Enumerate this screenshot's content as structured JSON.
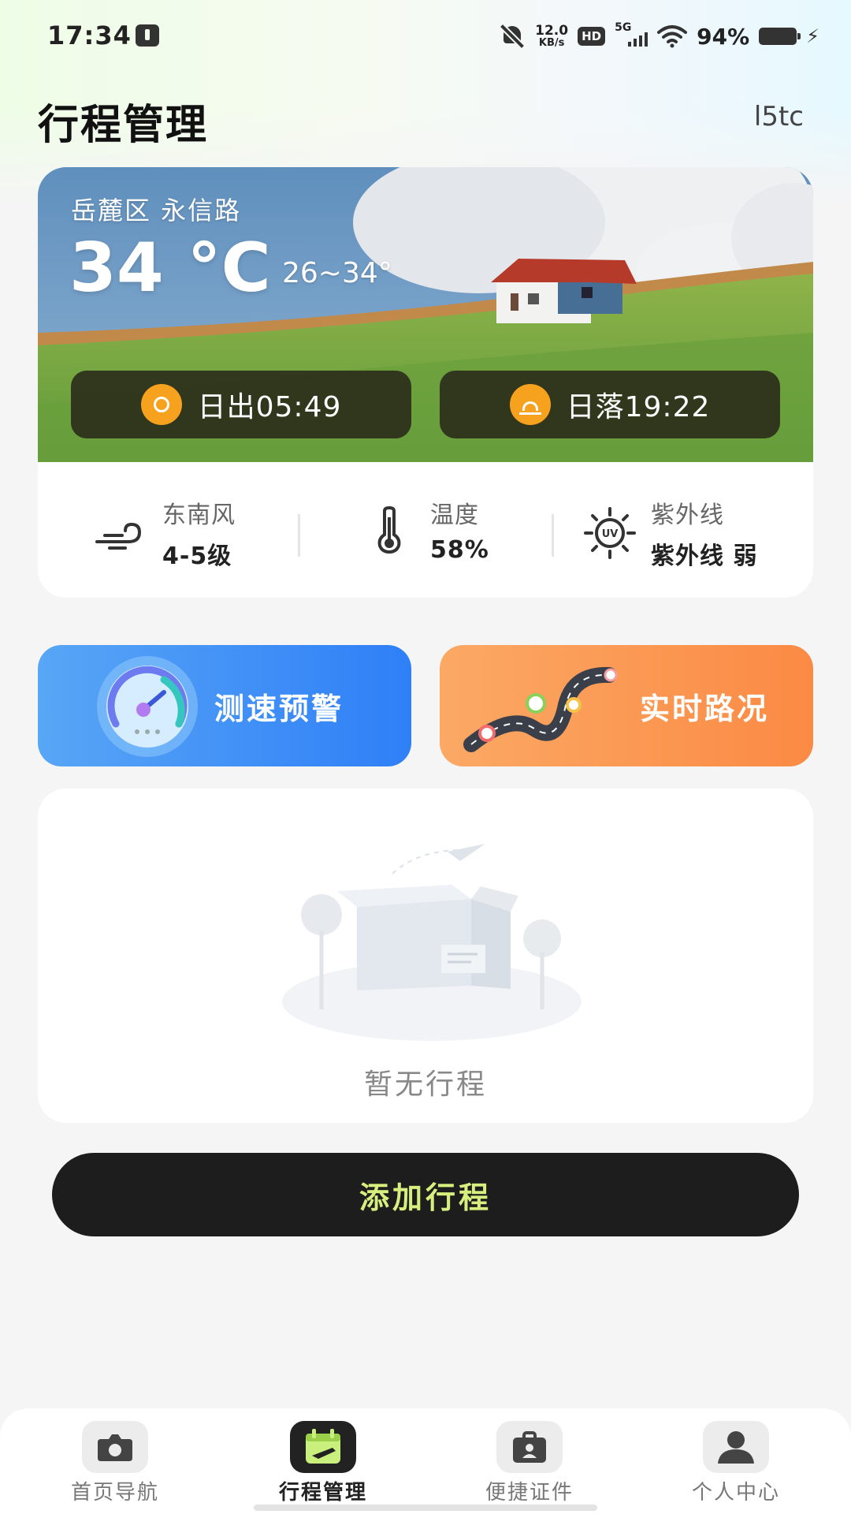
{
  "status_bar": {
    "time": "17:34",
    "net_speed_value": "12.0",
    "net_speed_unit": "KB/s",
    "hd_label": "HD",
    "network_label": "5G",
    "battery_percent": "94%"
  },
  "header": {
    "title": "行程管理",
    "right_code": "l5tc"
  },
  "weather": {
    "location": "岳麓区 永信路",
    "temperature": "34 °C",
    "range": "26~34°",
    "sunrise": "日出05:49",
    "sunset": "日落19:22",
    "stats": [
      {
        "label": "东南风",
        "value": "4-5级",
        "icon": "wind-icon"
      },
      {
        "label": "温度",
        "value": "58%",
        "icon": "thermometer-icon"
      },
      {
        "label": "紫外线",
        "value": "紫外线 弱",
        "icon": "uv-icon"
      }
    ]
  },
  "features": {
    "speed_warning": "测速预警",
    "live_traffic": "实时路况"
  },
  "trips": {
    "empty_text": "暂无行程"
  },
  "add_button": "添加行程",
  "nav": {
    "items": [
      {
        "label": "首页导航",
        "icon": "camera-icon"
      },
      {
        "label": "行程管理",
        "icon": "calendar-plane-icon"
      },
      {
        "label": "便捷证件",
        "icon": "id-badge-icon"
      },
      {
        "label": "个人中心",
        "icon": "person-icon"
      }
    ]
  },
  "colors": {
    "accent_dark": "#1d1d1d",
    "add_text": "#d7ef7e",
    "speed_blue": "#2f7ff7",
    "traffic_orange": "#fb8a44",
    "sun_orange": "#f6a21f"
  }
}
